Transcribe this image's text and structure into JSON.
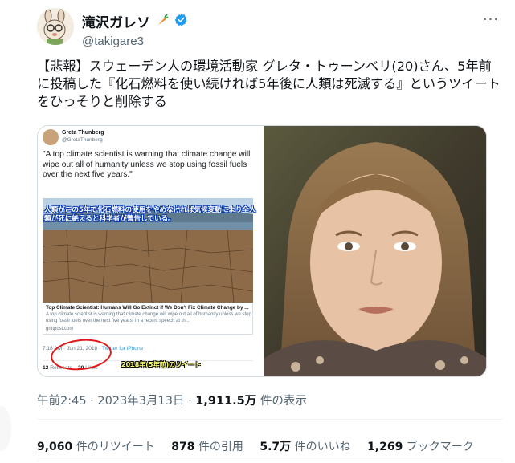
{
  "author": {
    "display_name": "滝沢ガレソ",
    "handle": "@takigare3",
    "verified": true
  },
  "more_label": "···",
  "tweet_text": "【悲報】スウェーデン人の環境活動家 グレタ・トゥーンベリ(20)さん、5年前に投稿した『化石燃料を使い続ければ5年後に人類は死滅する』というツイートをひっそりと削除する",
  "embedded_tweet": {
    "name": "Greta Thunberg",
    "handle": "@GretaThunberg",
    "text": "\"A top climate scientist is warning that climate change will wipe out all of humanity unless we stop using fossil fuels over the next five years.\"",
    "overlay_japanese": "人類がこの5年で化石燃料の使用をやめなければ気候変動により全人類が死に絶えると科学者が警告している。",
    "link_title": "Top Climate Scientist: Humans Will Go Extinct if We Don't Fix Climate Change by ...",
    "link_desc": "A top climate scientist is warning that climate change will wipe out all of humanity unless we stop using fossil fuels over the next five years. In a recent speech at th...",
    "link_domain": "grittpost.com",
    "time": "7:18 AM",
    "date": "Jun 21, 2018",
    "source": "Twitter for iPhone",
    "retweets_count": "12",
    "retweets_label": "Retweets",
    "likes_count": "20",
    "likes_label": "Likes",
    "caption": "2018年(5年前)のツイート"
  },
  "timestamp": "午前2:45 · 2023年3月13日 · ",
  "views_count": "1,911.5万",
  "views_label": " 件の表示",
  "stats": {
    "retweets_count": "9,060",
    "retweets_label": " 件のリツイート",
    "quotes_count": "878",
    "quotes_label": " 件の引用",
    "likes_count": "5.7万",
    "likes_label": " 件のいいね",
    "bookmarks_count": "1,269",
    "bookmarks_label": " ブックマーク"
  },
  "colors": {
    "verified": "#1d9bf0",
    "secondary_text": "#536471",
    "highlight_circle": "#e01818"
  }
}
